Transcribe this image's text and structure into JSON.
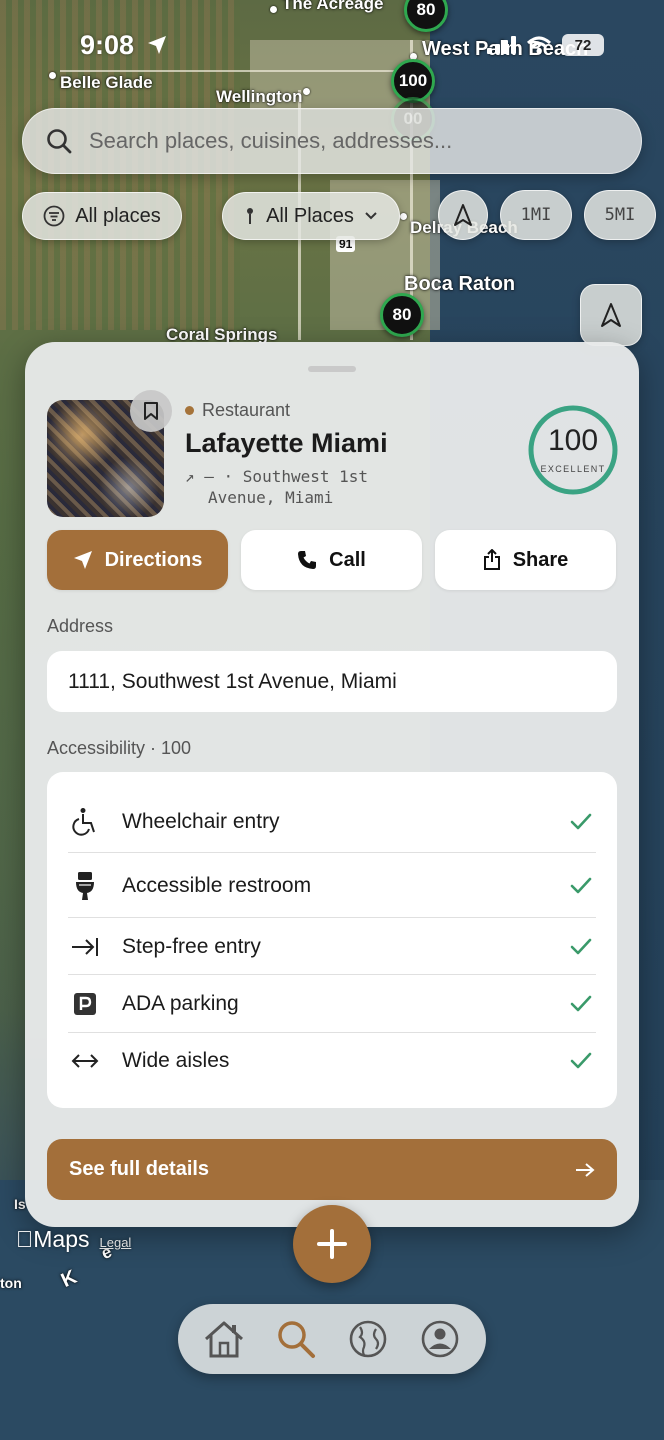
{
  "status_bar": {
    "time": "9:08",
    "battery": "72"
  },
  "map": {
    "labels": {
      "the_acreage": "The Acreage",
      "belle_glade": "Belle Glade",
      "wellington": "Wellington",
      "west_palm_beach": "West Palm Beach",
      "delray_beach": "Delray Beach",
      "boca_raton": "Boca Raton",
      "coral_springs": "Coral Springs",
      "highway_91": "91",
      "k_label": "K",
      "e_label": "e",
      "is_label": "Is",
      "ton_label": "ton"
    },
    "pins": [
      "80",
      "100",
      "00",
      "80"
    ]
  },
  "search": {
    "placeholder": "Search places, cuisines, addresses..."
  },
  "filters": {
    "all_places_chip": "All places",
    "all_places_dropdown": "All Places",
    "radius_1": "1MI",
    "radius_5": "5MI"
  },
  "place": {
    "category": "Restaurant",
    "name": "Lafayette Miami",
    "meta_line1": "↗ — · Southwest 1st",
    "meta_line2": "Avenue, Miami",
    "score": "100",
    "score_label": "EXCELLENT",
    "score_fraction": 1.0
  },
  "actions": {
    "directions": "Directions",
    "call": "Call",
    "share": "Share"
  },
  "address": {
    "label": "Address",
    "value": "1111, Southwest 1st Avenue, Miami"
  },
  "accessibility": {
    "label": "Accessibility · 100",
    "items": [
      {
        "label": "Wheelchair entry",
        "icon": "wheelchair-icon"
      },
      {
        "label": "Accessible restroom",
        "icon": "toilet-icon"
      },
      {
        "label": "Step-free entry",
        "icon": "step-free-icon"
      },
      {
        "label": "ADA parking",
        "icon": "parking-icon"
      },
      {
        "label": "Wide aisles",
        "icon": "wide-aisle-icon"
      }
    ]
  },
  "details_button": "See full details",
  "credit": {
    "maps": "Maps",
    "legal": "Legal"
  },
  "tabs": [
    "home-icon",
    "search-icon",
    "globe-icon",
    "profile-icon"
  ],
  "colors": {
    "accent": "#a36f3a",
    "score_ring": "#3aa383",
    "check": "#3a9a6a"
  }
}
